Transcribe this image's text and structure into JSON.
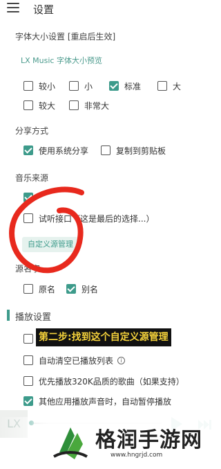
{
  "header": {
    "title": "设置"
  },
  "font_size": {
    "section_title": "字体大小设置 [重启后生效]",
    "preview_text": "LX Music 字体大小预览",
    "options": [
      {
        "label": "较小",
        "checked": false
      },
      {
        "label": "小",
        "checked": false
      },
      {
        "label": "标准",
        "checked": true
      },
      {
        "label": "大",
        "checked": false
      },
      {
        "label": "较大",
        "checked": false
      },
      {
        "label": "非常大",
        "checked": false
      }
    ]
  },
  "share": {
    "section_title": "分享方式",
    "options": [
      {
        "label": "使用系统分享",
        "checked": true
      },
      {
        "label": "复制到剪贴板",
        "checked": false
      }
    ]
  },
  "music_source": {
    "section_title": "音乐来源",
    "options": [
      {
        "label": "",
        "checked": true
      },
      {
        "label": "试听接口（这是最后的选择...）",
        "checked": false
      }
    ],
    "manage_button": "自定义源管理"
  },
  "source_name": {
    "section_title": "源名字",
    "options": [
      {
        "label": "原名",
        "checked": false
      },
      {
        "label": "别名",
        "checked": true
      }
    ]
  },
  "playback": {
    "section_title": "播放设置",
    "options": [
      {
        "label": "",
        "checked": false
      },
      {
        "label": "自动清空已播放列表",
        "checked": false,
        "info_icon": "info-icon"
      },
      {
        "label": "优先播放320K品质的歌曲（如果支持）",
        "checked": false
      },
      {
        "label": "其他应用播放声音时，自动暂停播放",
        "checked": true
      }
    ]
  },
  "caption": {
    "text": "第二步:找到这个自定义源管理"
  },
  "player": {
    "logo": "LX"
  },
  "watermark": {
    "title": "格润手游网",
    "url": "www.hngrjd.com"
  },
  "colors": {
    "accent": "#3d9b8b",
    "annotation_red": "#e8291d",
    "caption_text": "#f5d23b"
  }
}
